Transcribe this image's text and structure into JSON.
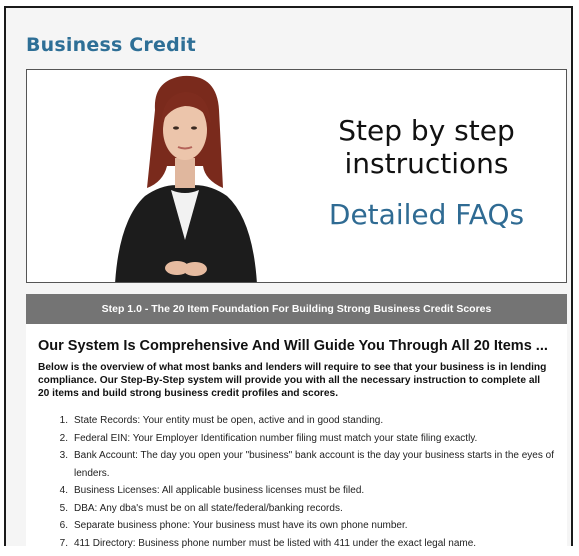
{
  "page": {
    "title": "Business Credit"
  },
  "media": {
    "line1": "Step by step",
    "line2": "instructions",
    "line3": "Detailed FAQs"
  },
  "step_bar": {
    "label": "Step 1.0 - The 20 Item Foundation For Building Strong Business Credit Scores"
  },
  "content": {
    "heading": "Our System Is Comprehensive And Will Guide You Through All 20 Items ...",
    "intro": "Below is the overview of what most banks and lenders will require to see that your business is in lending compliance. Our Step-By-Step system will provide you with all the necessary instruction to complete all 20 items and build strong business credit profiles and scores.",
    "items": [
      {
        "num": "1.",
        "text": "State Records: Your entity must be open, active and in good standing."
      },
      {
        "num": "2.",
        "text": "Federal EIN: Your Employer Identification number filing must match your state filing exactly."
      },
      {
        "num": "3.",
        "text": "Bank Account: The day you open your \"business\" bank account is the day your business starts in the eyes of lenders."
      },
      {
        "num": "4.",
        "text": "Business Licenses: All applicable business licenses must be filed."
      },
      {
        "num": "5.",
        "text": "DBA: Any dba's must be on all state/federal/banking records."
      },
      {
        "num": "6.",
        "text": "Separate business phone: Your business must have its own phone number."
      },
      {
        "num": "7.",
        "text": "411 Directory: Business phone number must be listed with 411 under the exact legal name."
      }
    ]
  },
  "colors": {
    "title": "#2e6f96",
    "faq": "#2f6b93",
    "step_bar_bg": "#747474"
  }
}
